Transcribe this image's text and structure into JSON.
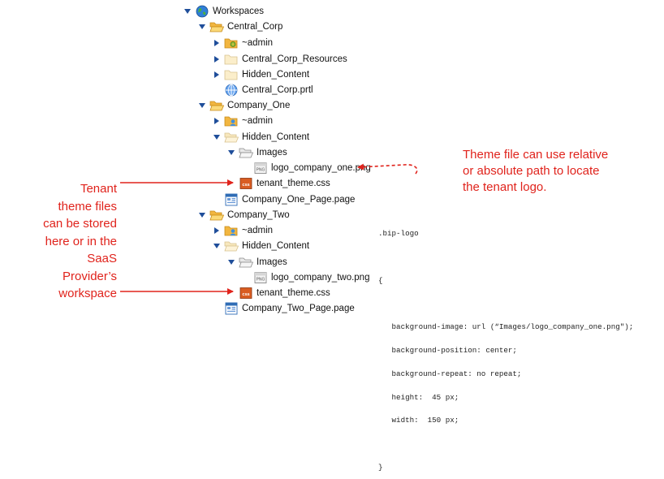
{
  "tree": {
    "workspaces": "Workspaces",
    "central_corp": "Central_Corp",
    "cc_admin": "~admin",
    "cc_resources": "Central_Corp_Resources",
    "cc_hidden": "Hidden_Content",
    "cc_portal": "Central_Corp.prtl",
    "company_one": "Company_One",
    "c1_admin": "~admin",
    "c1_hidden": "Hidden_Content",
    "c1_images": "Images",
    "c1_logo": "logo_company_one.png",
    "c1_theme": "tenant_theme.css",
    "c1_page": "Company_One_Page.page",
    "company_two": "Company_Two",
    "c2_admin": "~admin",
    "c2_hidden": "Hidden_Content",
    "c2_images": "Images",
    "c2_logo": "logo_company_two.png",
    "c2_theme": "tenant_theme.css",
    "c2_page": "Company_Two_Page.page"
  },
  "annotations": {
    "tenant_lines": [
      "Tenant",
      "theme files",
      "can be stored",
      "here or in the",
      "SaaS",
      "Provider’s",
      "workspace"
    ],
    "theme_lines": [
      "Theme file can use relative",
      "or absolute path to locate",
      "the tenant logo."
    ]
  },
  "css_code": [
    ".bip-logo",
    "",
    "{",
    "",
    "   background-image: url (“Images/logo_company_one.png\");",
    "   background-position: center;",
    "   background-repeat: no repeat;",
    "   height:  45 px;",
    "   width:  150 px;",
    "",
    "}"
  ],
  "colors": {
    "accent_red": "#e0231c",
    "folder": "#f2b640",
    "arrow_blue": "#1f4e9a"
  }
}
